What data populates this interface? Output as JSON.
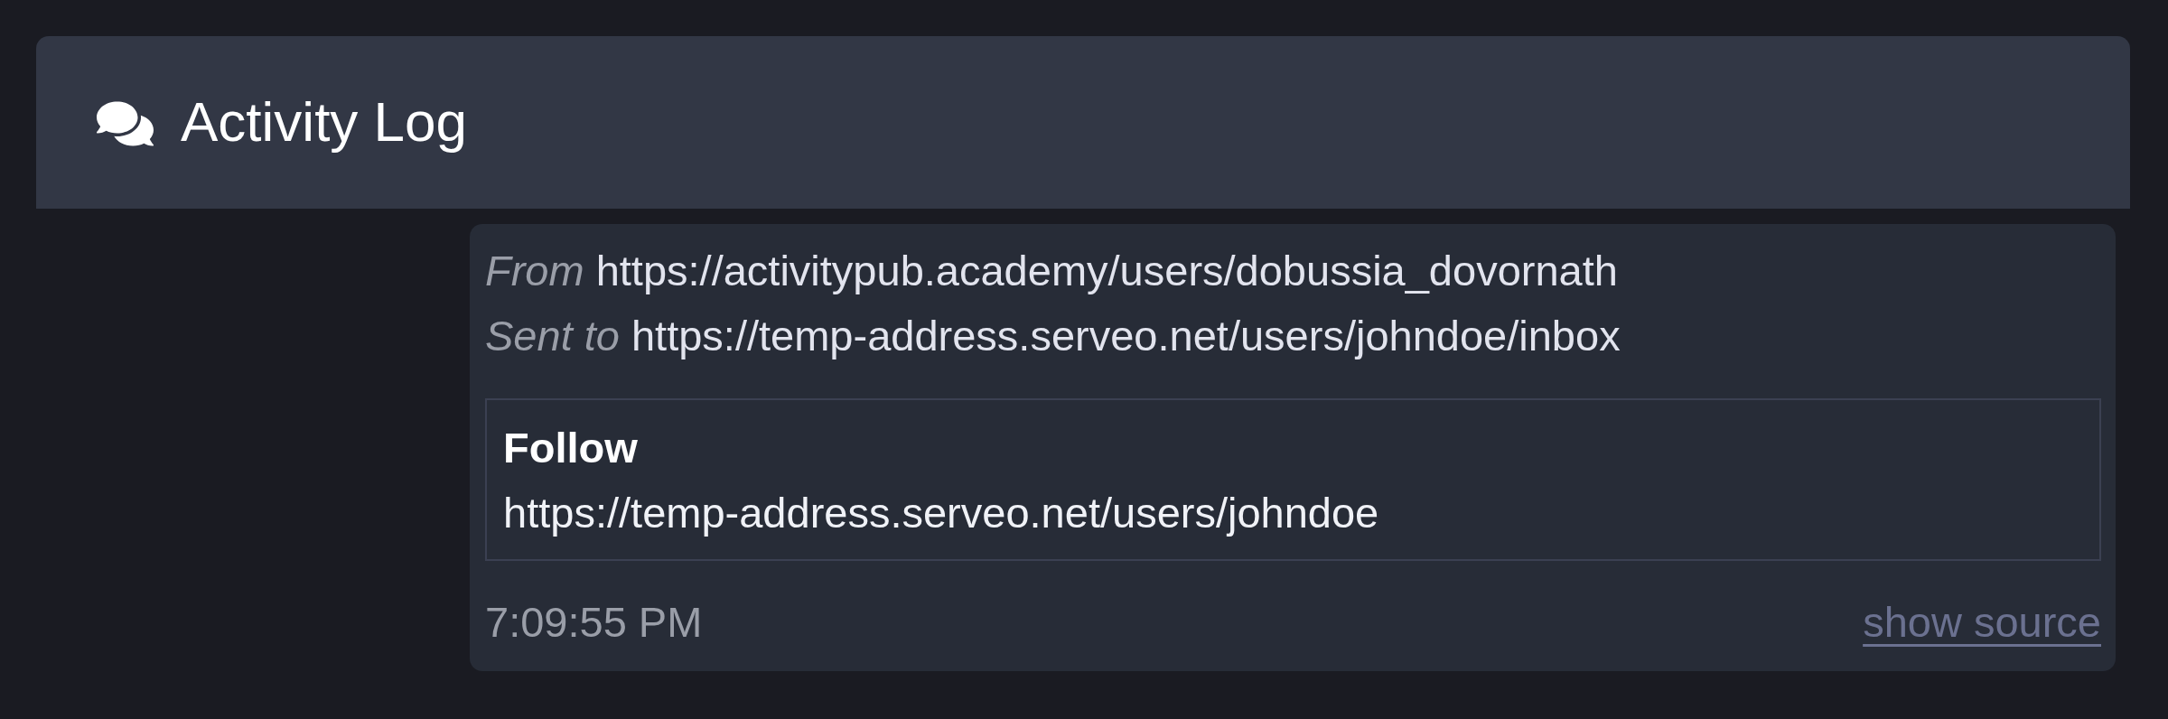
{
  "header": {
    "title": "Activity Log"
  },
  "activity": {
    "from_label": "From",
    "from": "https://activitypub.academy/users/dobussia_dovornath",
    "sent_to_label": "Sent to",
    "sent_to": "https://temp-address.serveo.net/users/johndoe/inbox",
    "object": {
      "heading": "Follow",
      "actor": "https://temp-address.serveo.net/users/johndoe"
    },
    "time": "7:09:55 PM",
    "source_link": "show source"
  }
}
